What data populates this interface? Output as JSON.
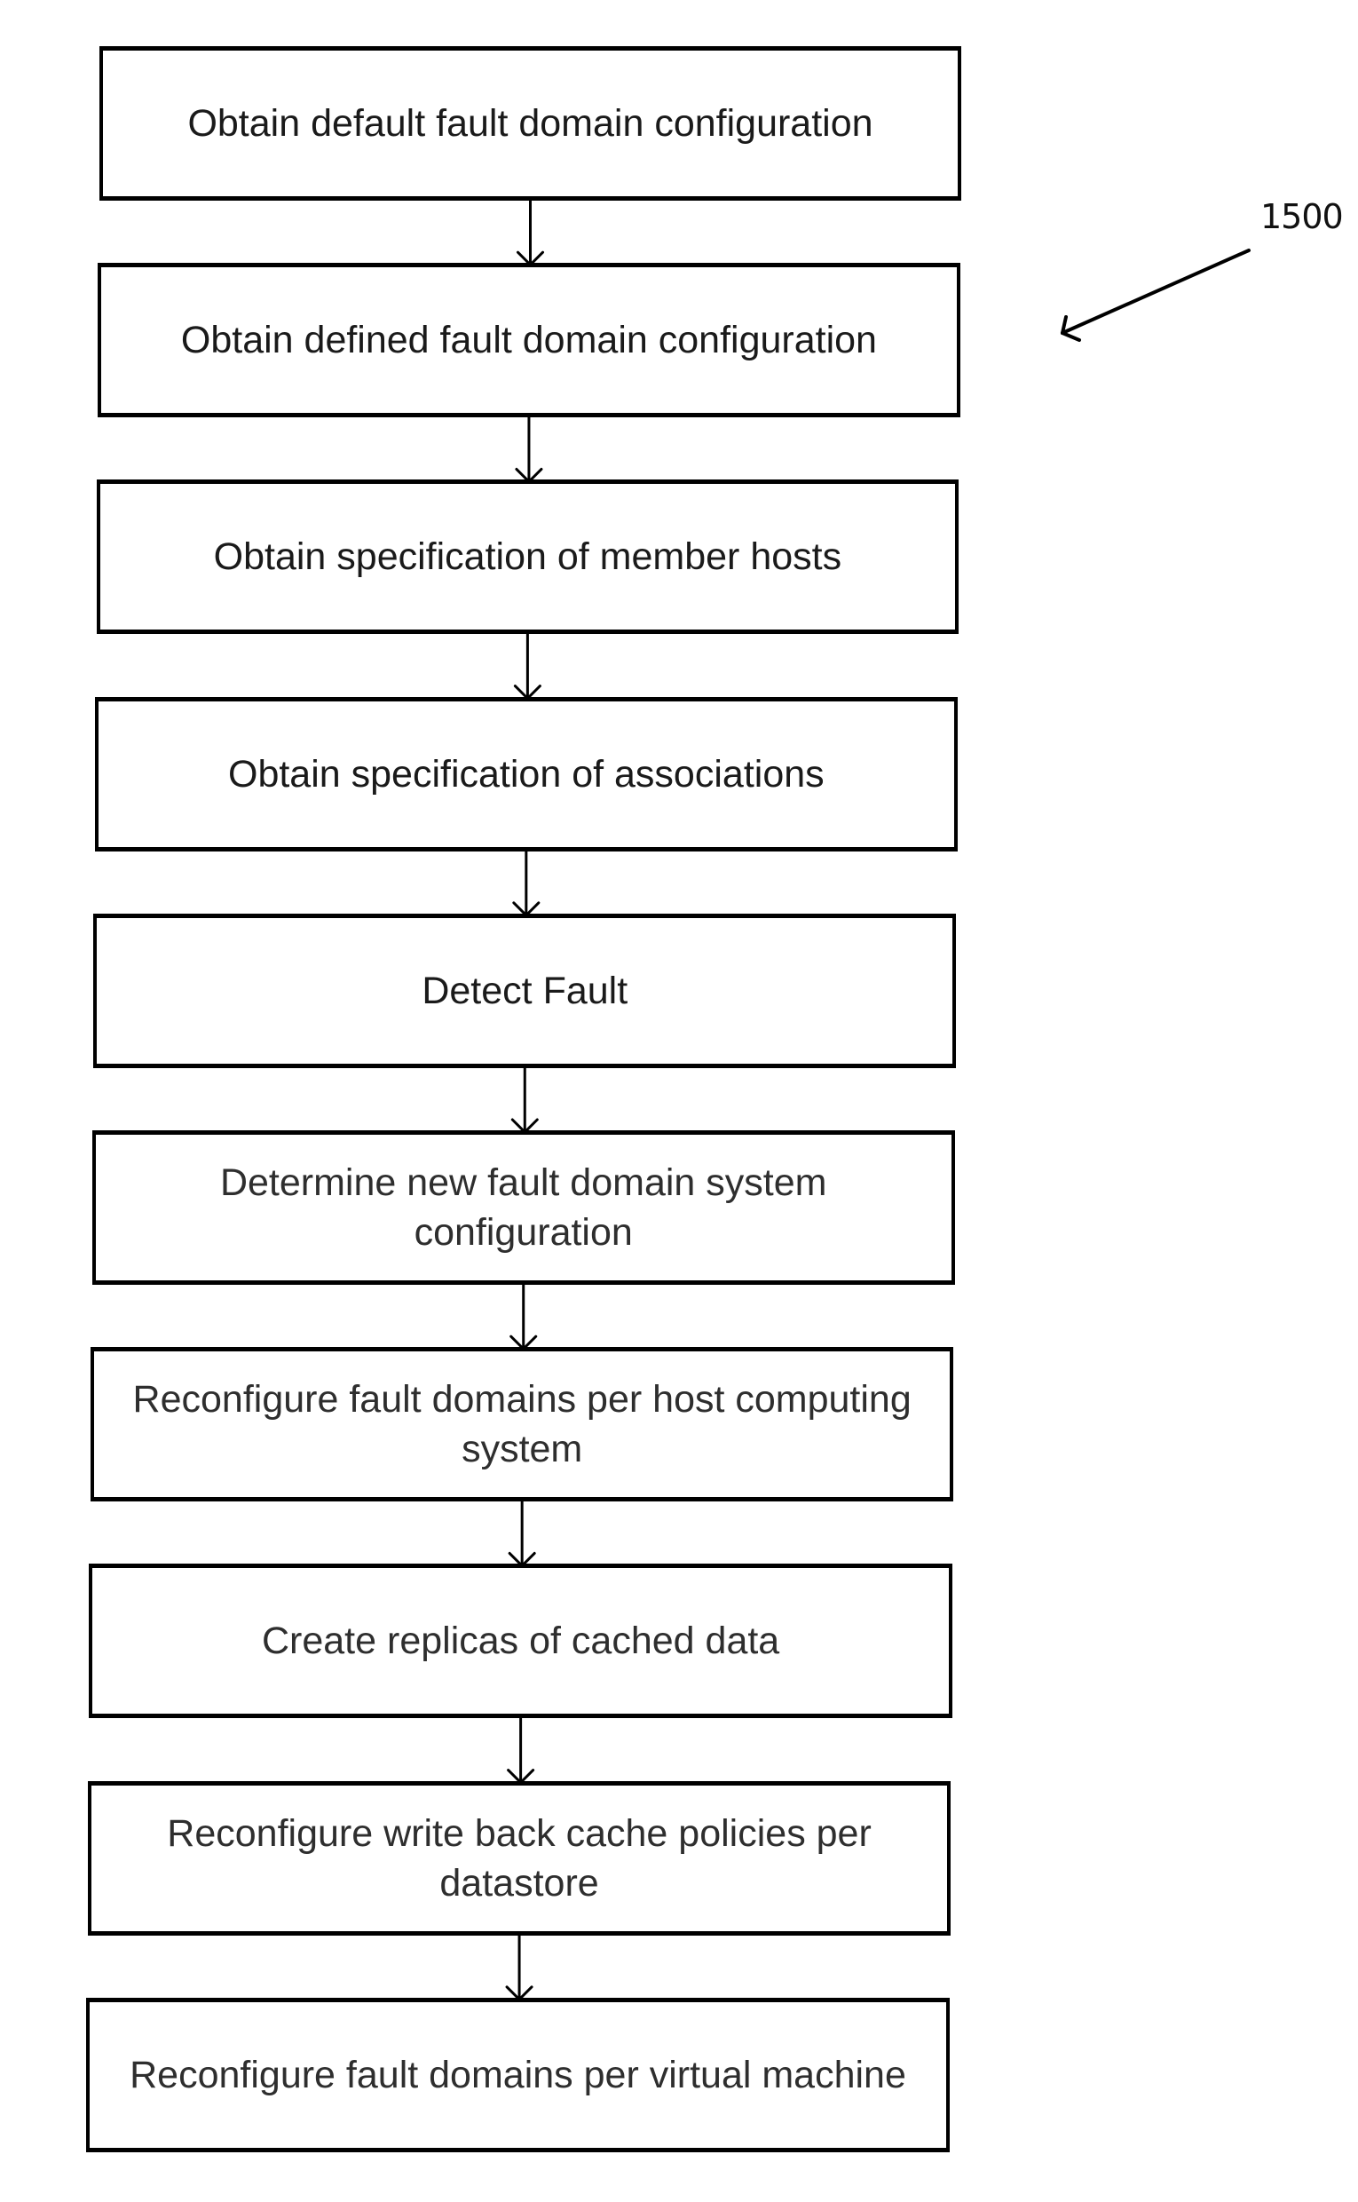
{
  "figure": {
    "reference_number": "1500",
    "steps": [
      {
        "label": "Obtain default fault domain configuration"
      },
      {
        "label": "Obtain defined fault domain configuration"
      },
      {
        "label": "Obtain specification of member hosts"
      },
      {
        "label": "Obtain specification of associations"
      },
      {
        "label": "Detect Fault"
      },
      {
        "label": "Determine new fault domain system configuration"
      },
      {
        "label": "Reconfigure fault domains per host computing system"
      },
      {
        "label": "Create replicas of cached data"
      },
      {
        "label": "Reconfigure write back cache policies per datastore"
      },
      {
        "label": "Reconfigure fault domains per virtual machine"
      }
    ]
  }
}
